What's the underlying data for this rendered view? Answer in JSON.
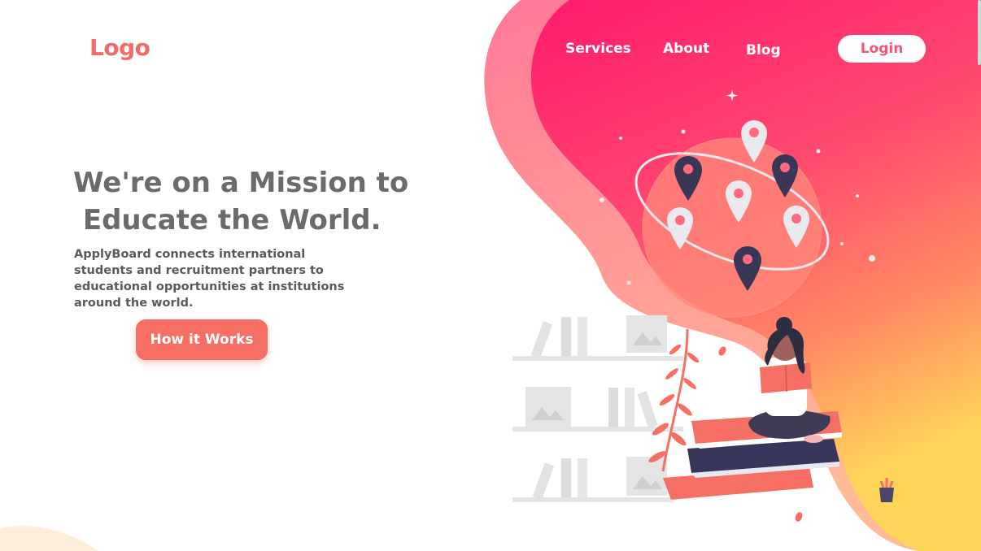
{
  "brand": {
    "logo_text": "Logo"
  },
  "nav": {
    "items": [
      {
        "label": "Services"
      },
      {
        "label": "About"
      },
      {
        "label": "Blog"
      }
    ],
    "login_label": "Login"
  },
  "hero": {
    "headline": "We're on a Mission to\n Educate the World.",
    "description": "ApplyBoard connects international students and recruitment partners to educational opportunities at institutions around the world.",
    "cta_label": "How it Works"
  },
  "colors": {
    "accent": "#f56f64",
    "logo": "#f26b6b",
    "gradient_top": "#ff1a6e",
    "gradient_bottom": "#ffc75a",
    "heading_text": "#6b6b6b"
  },
  "icons": [
    "map-pin-icon",
    "globe-illustration",
    "reading-woman-illustration",
    "bookshelf-illustration",
    "plant-icon"
  ]
}
